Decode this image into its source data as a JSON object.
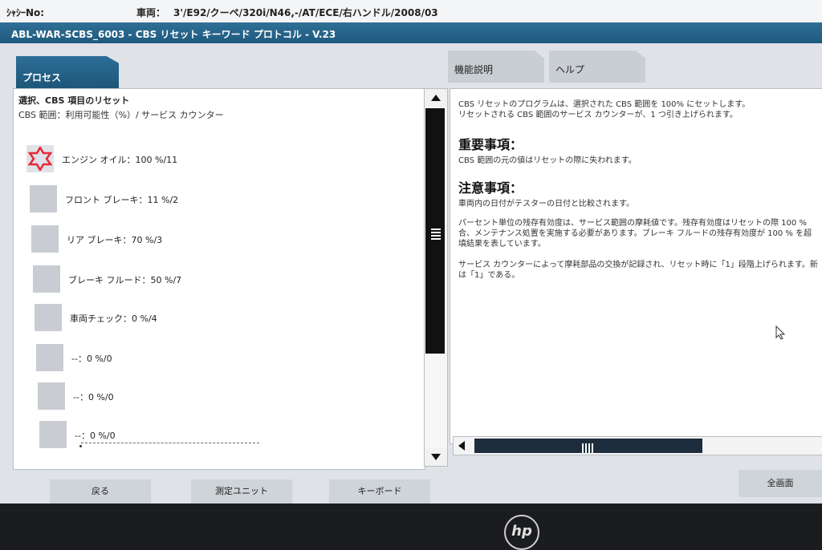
{
  "header": {
    "chassis_label": "ｼｬｼｰNo:",
    "vehicle_label": "車両：",
    "vehicle_value": "3'/E92/クーペ/320i/N46,-/AT/ECE/右ハンドル/2008/03"
  },
  "title_bar": {
    "title": "ABL-WAR-SCBS_6003 - CBS リセット キーワード プロトコル - V.23"
  },
  "tabs": {
    "process": "プロセス",
    "function": "機能説明",
    "help": "ヘルプ"
  },
  "left_panel": {
    "heading": "選択、CBS 項目のリセット",
    "subheading": "CBS 範囲：利用可能性（%）/ サービス カウンター",
    "items": [
      {
        "label": "エンジン オイル：100 %/11",
        "selected": true
      },
      {
        "label": "フロント ブレーキ：11 %/2",
        "selected": false
      },
      {
        "label": "リア ブレーキ：70 %/3",
        "selected": false
      },
      {
        "label": "ブレーキ フルード：50 %/7",
        "selected": false
      },
      {
        "label": "車両チェック：0 %/4",
        "selected": false
      },
      {
        "label": "--：0 %/0",
        "selected": false
      },
      {
        "label": "--：0 %/0",
        "selected": false
      },
      {
        "label": "--：0 %/0",
        "selected": false
      }
    ]
  },
  "right_panel": {
    "intro_1": "CBS リセットのプログラムは、選択された CBS 範囲を 100% にセットします。",
    "intro_2": "リセットされる CBS 範囲のサービス カウンターが、1 つ引き上げられます。",
    "important_heading": "重要事項：",
    "important_text": "CBS 範囲の元の値はリセットの際に失われます。",
    "note_heading": "注意事項：",
    "note_1": "車両内の日付がテスターの日付と比較されます。",
    "note_2a": "パーセント単位の残存有効度は、サービス範囲の摩耗値です。残存有効度はリセットの際 100 %",
    "note_2b": "合、メンテナンス処置を実施する必要があります。ブレーキ フルードの残存有効度が 100 % を超",
    "note_2c": "填結果を表しています。",
    "note_3a": "サービス カウンターによって摩耗部品の交換が記録され、リセット時に「1」段階上げられます。新",
    "note_3b": "は「1」である。"
  },
  "buttons": {
    "back": "戻る",
    "measure": "測定ユニット",
    "keyboard": "キーボード",
    "fullscreen": "全画面"
  },
  "device": {
    "brand": "hp"
  },
  "colors": {
    "title_bar": "#1f5a7e",
    "selected_star": "#e8283a",
    "scroll_thumb": "#111111"
  }
}
